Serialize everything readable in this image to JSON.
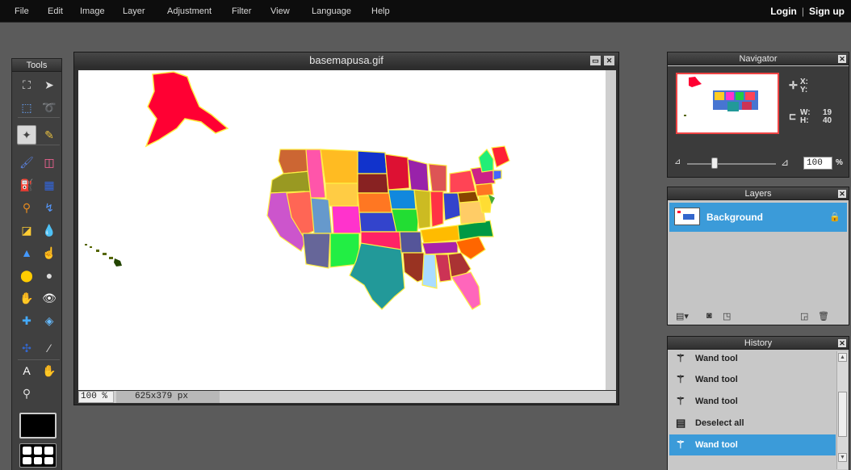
{
  "menu": {
    "items": [
      "File",
      "Edit",
      "Image",
      "Layer",
      "Adjustment",
      "Filter",
      "View",
      "Language",
      "Help"
    ],
    "login": "Login",
    "separator": "|",
    "signup": "Sign up"
  },
  "tools": {
    "title": "Tools",
    "items": [
      {
        "name": "crop-icon",
        "glyph": "⛶"
      },
      {
        "name": "move-icon",
        "glyph": "➤"
      },
      {
        "name": "marquee-icon",
        "glyph": "⬚"
      },
      {
        "name": "lasso-icon",
        "glyph": "➰"
      },
      {
        "name": "magic-wand-icon",
        "glyph": "✦"
      },
      {
        "name": "pencil-icon",
        "glyph": "✎"
      },
      {
        "name": "brush-icon",
        "glyph": "🖌"
      },
      {
        "name": "eraser-icon",
        "glyph": "◫"
      },
      {
        "name": "fill-bucket-icon",
        "glyph": "⛽"
      },
      {
        "name": "gradient-icon",
        "glyph": "▦"
      },
      {
        "name": "clone-stamp-icon",
        "glyph": "⚲"
      },
      {
        "name": "color-replace-icon",
        "glyph": "↯"
      },
      {
        "name": "drawing-icon",
        "glyph": "◪"
      },
      {
        "name": "blur-icon",
        "glyph": "💧"
      },
      {
        "name": "sharpen-icon",
        "glyph": "▲"
      },
      {
        "name": "smudge-icon",
        "glyph": "☝"
      },
      {
        "name": "sponge-icon",
        "glyph": "⬤"
      },
      {
        "name": "dodge-icon",
        "glyph": "●"
      },
      {
        "name": "burn-icon",
        "glyph": "✋"
      },
      {
        "name": "red-eye-icon",
        "glyph": "👁"
      },
      {
        "name": "spot-heal-icon",
        "glyph": "✚"
      },
      {
        "name": "bloat-icon",
        "glyph": "◈"
      },
      {
        "name": "pinch-icon",
        "glyph": "✣"
      },
      {
        "name": "color-picker-icon",
        "glyph": "⁄"
      },
      {
        "name": "type-icon",
        "glyph": "A"
      },
      {
        "name": "hand-icon",
        "glyph": "✋"
      },
      {
        "name": "zoom-icon",
        "glyph": "⚲"
      }
    ]
  },
  "document": {
    "title": "basemapusa.gif",
    "zoom": "100 %",
    "dimensions": "625x379 px"
  },
  "navigator": {
    "title": "Navigator",
    "x_label": "X:",
    "y_label": "Y:",
    "w_label": "W:",
    "h_label": "H:",
    "w_value": "19",
    "h_value": "40",
    "zoom_value": "100",
    "zoom_unit": "%"
  },
  "layers": {
    "title": "Layers",
    "items": [
      {
        "name": "Background",
        "locked": true
      }
    ]
  },
  "history": {
    "title": "History",
    "items": [
      {
        "label": "Wand tool",
        "icon": "magic-wand-icon",
        "selected": false
      },
      {
        "label": "Wand tool",
        "icon": "magic-wand-icon",
        "selected": false
      },
      {
        "label": "Wand tool",
        "icon": "magic-wand-icon",
        "selected": false
      },
      {
        "label": "Deselect all",
        "icon": "deselect-icon",
        "selected": false
      },
      {
        "label": "Wand tool",
        "icon": "magic-wand-icon",
        "selected": true
      }
    ]
  }
}
